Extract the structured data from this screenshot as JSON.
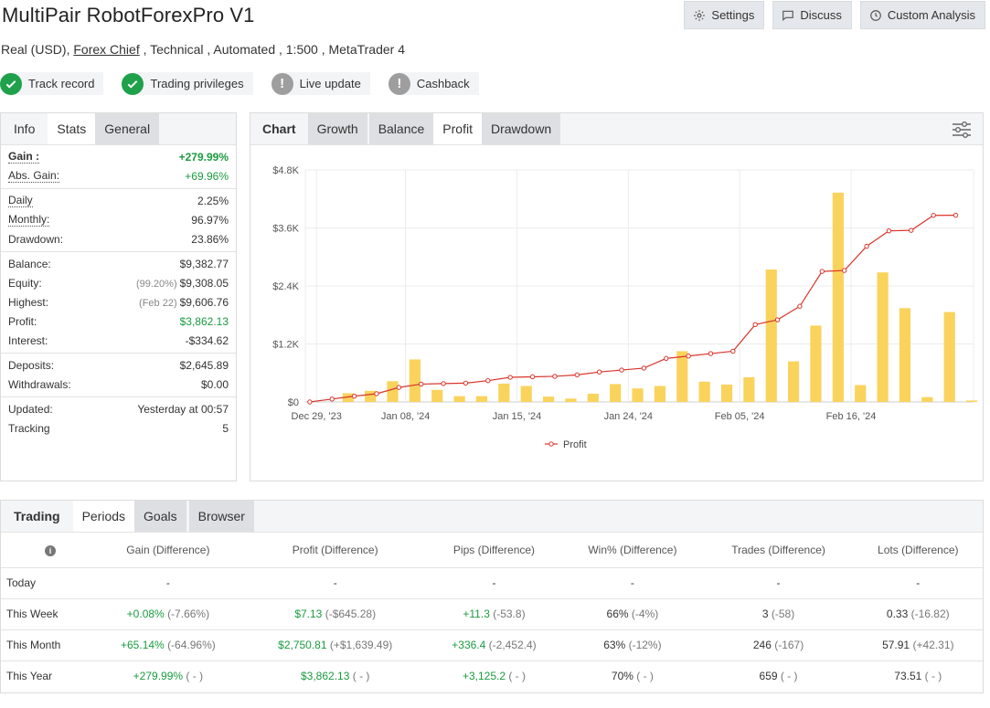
{
  "title": "MultiPair RobotForexPro V1",
  "top_buttons": [
    {
      "label": "Settings",
      "icon": "gear-icon"
    },
    {
      "label": "Discuss",
      "icon": "chat-icon"
    },
    {
      "label": "Custom Analysis",
      "icon": "clock-icon"
    }
  ],
  "subtitle": {
    "prefix": "Real (USD), ",
    "broker": "Forex Chief",
    "suffix": " , Technical , Automated , 1:500 , MetaTrader 4"
  },
  "badges": [
    {
      "label": "Track record",
      "status": "ok"
    },
    {
      "label": "Trading privileges",
      "status": "ok"
    },
    {
      "label": "Live update",
      "status": "na"
    },
    {
      "label": "Cashback",
      "status": "na"
    }
  ],
  "stats_tabs": [
    "Info",
    "Stats",
    "General"
  ],
  "stats": {
    "gain": {
      "label": "Gain :",
      "value": "+279.99%"
    },
    "abs_gain": {
      "label": "Abs. Gain:",
      "value": "+69.96%"
    },
    "daily": {
      "label": "Daily",
      "value": "2.25%"
    },
    "monthly": {
      "label": "Monthly:",
      "value": "96.97%"
    },
    "drawdown": {
      "label": "Drawdown:",
      "value": "23.86%"
    },
    "balance": {
      "label": "Balance:",
      "value": "$9,382.77"
    },
    "equity": {
      "label": "Equity:",
      "note": "(99.20%)",
      "value": "$9,308.05"
    },
    "highest": {
      "label": "Highest:",
      "note": "(Feb 22)",
      "value": "$9,606.76"
    },
    "profit": {
      "label": "Profit:",
      "value": "$3,862.13"
    },
    "interest": {
      "label": "Interest:",
      "value": "-$334.62"
    },
    "deposits": {
      "label": "Deposits:",
      "value": "$2,645.89"
    },
    "withdrawals": {
      "label": "Withdrawals:",
      "value": "$0.00"
    },
    "updated": {
      "label": "Updated:",
      "value": "Yesterday at 00:57"
    },
    "tracking": {
      "label": "Tracking",
      "value": "5"
    }
  },
  "chart_tabs": [
    "Chart",
    "Growth",
    "Balance",
    "Profit",
    "Drawdown"
  ],
  "chart_data": {
    "type": "bar",
    "legend": "Profit",
    "legend_position": "bottom-center",
    "grid": true,
    "y_ticks": [
      "$0",
      "$1.2K",
      "$2.4K",
      "$3.6K",
      "$4.8K"
    ],
    "ylim": [
      0,
      4800
    ],
    "x_tick_labels": [
      "Dec 29, '23",
      "Jan 08, '24",
      "Jan 15, '24",
      "Jan 24, '24",
      "Feb 05, '24",
      "Feb 16, '24"
    ],
    "x_tick_index": [
      0,
      4,
      9,
      14,
      19,
      24
    ],
    "bar_color": "#f9d35c",
    "line_color": "#d9342b",
    "bars": [
      0,
      180,
      230,
      430,
      880,
      250,
      120,
      120,
      380,
      330,
      110,
      70,
      170,
      370,
      280,
      330,
      1050,
      420,
      360,
      510,
      2740,
      840,
      1580,
      4330,
      350,
      2680,
      1940,
      100,
      1860,
      30
    ],
    "line": [
      0,
      60,
      120,
      170,
      300,
      370,
      380,
      390,
      440,
      510,
      520,
      530,
      560,
      620,
      660,
      700,
      900,
      950,
      1000,
      1050,
      1600,
      1700,
      1980,
      2700,
      2720,
      3220,
      3540,
      3550,
      3860,
      3862
    ]
  },
  "trading_tabs": [
    "Trading",
    "Periods",
    "Goals",
    "Browser"
  ],
  "periods": {
    "columns": [
      "Gain (Difference)",
      "Profit (Difference)",
      "Pips (Difference)",
      "Win% (Difference)",
      "Trades (Difference)",
      "Lots (Difference)"
    ],
    "rows": [
      {
        "label": "Today",
        "cells": [
          [
            "-",
            ""
          ],
          [
            "-",
            ""
          ],
          [
            "-",
            ""
          ],
          [
            "-",
            ""
          ],
          [
            "-",
            ""
          ],
          [
            "-",
            ""
          ]
        ]
      },
      {
        "label": "This Week",
        "cells": [
          [
            "+0.08%",
            "(-7.66%)"
          ],
          [
            "$7.13",
            "(-$645.28)"
          ],
          [
            "+11.3",
            "(-53.8)"
          ],
          [
            "66%",
            "(-4%)"
          ],
          [
            "3",
            "(-58)"
          ],
          [
            "0.33",
            "(-16.82)"
          ]
        ]
      },
      {
        "label": "This Month",
        "cells": [
          [
            "+65.14%",
            "(-64.96%)"
          ],
          [
            "$2,750.81",
            "(+$1,639.49)"
          ],
          [
            "+336.4",
            "(-2,452.4)"
          ],
          [
            "63%",
            "(-12%)"
          ],
          [
            "246",
            "(-167)"
          ],
          [
            "57.91",
            "(+42.31)"
          ]
        ]
      },
      {
        "label": "This Year",
        "cells": [
          [
            "+279.99%",
            "( - )"
          ],
          [
            "$3,862.13",
            "( - )"
          ],
          [
            "+3,125.2",
            "( - )"
          ],
          [
            "70%",
            "( - )"
          ],
          [
            "659",
            "( - )"
          ],
          [
            "73.51",
            "( - )"
          ]
        ]
      }
    ],
    "green_columns": [
      0,
      1,
      2
    ]
  }
}
